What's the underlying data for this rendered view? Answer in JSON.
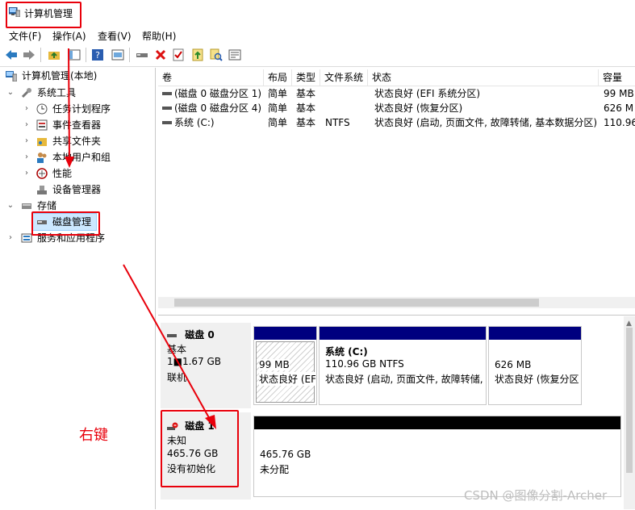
{
  "window": {
    "title": "计算机管理"
  },
  "menu": [
    "文件(F)",
    "操作(A)",
    "查看(V)",
    "帮助(H)"
  ],
  "toolbar_icons": [
    "back-icon",
    "forward-icon",
    "up-folder-icon",
    "show-hide-tree-icon",
    "help-icon",
    "properties-icon",
    "connect-icon",
    "delete-icon",
    "check-icon",
    "import-icon",
    "search-icon",
    "export-icon"
  ],
  "tree": {
    "root": "计算机管理(本地)",
    "system_tools": "系统工具",
    "task_scheduler": "任务计划程序",
    "event_viewer": "事件查看器",
    "shared_folders": "共享文件夹",
    "local_users": "本地用户和组",
    "performance": "性能",
    "device_manager": "设备管理器",
    "storage": "存储",
    "disk_management": "磁盘管理",
    "services_apps": "服务和应用程序"
  },
  "volumes": {
    "headers": [
      "卷",
      "布局",
      "类型",
      "文件系统",
      "状态",
      "容量"
    ],
    "rows": [
      {
        "name": "(磁盘 0 磁盘分区 1)",
        "layout": "简单",
        "type": "基本",
        "fs": "",
        "status": "状态良好 (EFI 系统分区)",
        "capacity": "99 MB"
      },
      {
        "name": "(磁盘 0 磁盘分区 4)",
        "layout": "简单",
        "type": "基本",
        "fs": "",
        "status": "状态良好 (恢复分区)",
        "capacity": "626 M"
      },
      {
        "name": "系统 (C:)",
        "layout": "简单",
        "type": "基本",
        "fs": "NTFS",
        "status": "状态良好 (启动, 页面文件, 故障转储, 基本数据分区)",
        "capacity": "110.96"
      }
    ]
  },
  "disk0": {
    "name": "磁盘 0",
    "type": "基本",
    "size": "1■1.67 GB",
    "status": "联机",
    "partitions": [
      {
        "size": "99 MB",
        "status": "状态良好 (EFI"
      },
      {
        "label": "系统 (C:)",
        "size": "110.96 GB NTFS",
        "status": "状态良好 (启动, 页面文件, 故障转储,"
      },
      {
        "size": "626 MB",
        "status": "状态良好 (恢复分区"
      }
    ]
  },
  "disk1": {
    "name": "磁盘 1",
    "type": "未知",
    "size": "465.76 GB",
    "status": "没有初始化",
    "partition": {
      "size": "465.76 GB",
      "status": "未分配"
    }
  },
  "annotation": "右键",
  "watermark": "CSDN @图像分割-Archer",
  "colors": {
    "annotation_red": "#e8000b",
    "partition_header_blue": "#00007f",
    "unallocated_black": "#000000",
    "selection": "#cce8ff"
  }
}
